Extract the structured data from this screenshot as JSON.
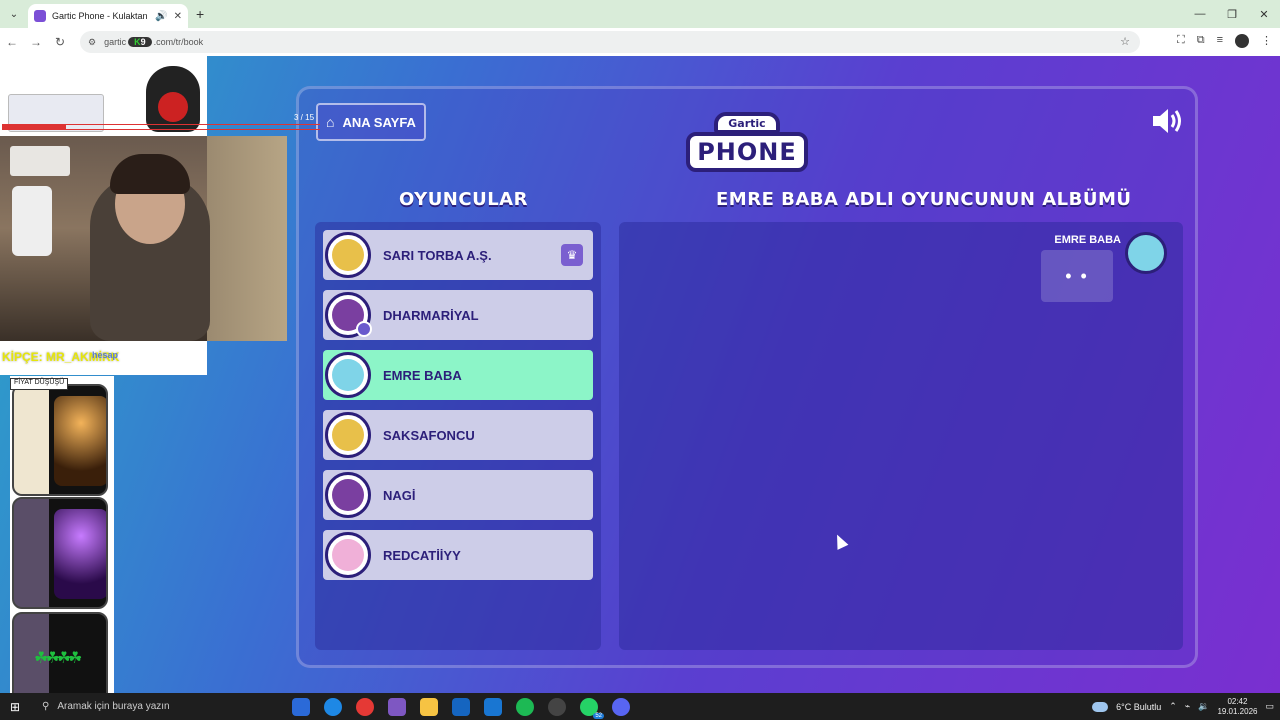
{
  "browser": {
    "tab_title": "Gartic Phone - Kulaktan Kul",
    "url_prefix": "gartic",
    "url_suffix": ".com/tr/book",
    "overlay_number": "9"
  },
  "game": {
    "home_button": "ANA SAYFA",
    "logo_top": "Gartic",
    "logo_main": "PHONE",
    "players_title": "OYUNCULAR",
    "album_title": "EMRE BABA ADLI OYUNCUNUN ALBÜMÜ",
    "players": [
      {
        "name": "SARI TORBA A.Ş.",
        "host": true,
        "active": false,
        "color": "#e8c04a"
      },
      {
        "name": "DHARMARİYAL",
        "host": false,
        "active": false,
        "color": "#7a3fa0"
      },
      {
        "name": "EMRE BABA",
        "host": false,
        "active": true,
        "color": "#7fd4e8"
      },
      {
        "name": "SAKSAFONCU",
        "host": false,
        "active": false,
        "color": "#e8c04a"
      },
      {
        "name": "NAGİ",
        "host": false,
        "active": false,
        "color": "#7a3fa0"
      },
      {
        "name": "REDCATİİYY",
        "host": false,
        "active": false,
        "color": "#f0b0d8"
      }
    ],
    "album": {
      "author": "EMRE BABA",
      "bubble": "• •"
    }
  },
  "stream": {
    "progress_text": "3 / 15",
    "progress_fraction": 0.2,
    "ticker": "KİPÇE: MR_AKMİRK",
    "brand_tag": "hesap",
    "ad_label": "FİYAT DÜŞÜŞÜ"
  },
  "taskbar": {
    "search_placeholder": "Aramak için buraya yazın",
    "weather": "6°C  Bulutlu",
    "time": "02:42",
    "date": "19.01.2026",
    "whatsapp_badge": "52"
  },
  "colors": {
    "accent_navy": "#2c1f7a",
    "active_player": "#8cf5c8",
    "player_row": "#cdcde8"
  }
}
